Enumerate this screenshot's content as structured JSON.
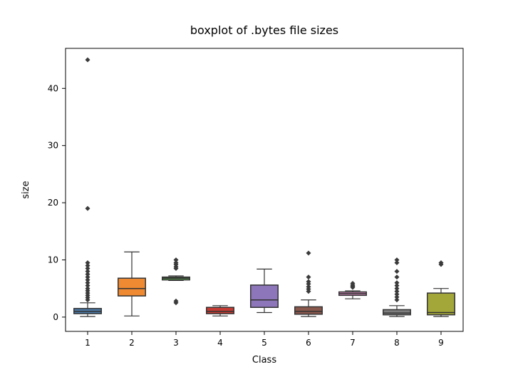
{
  "chart_data": {
    "type": "box",
    "title": "boxplot of .bytes file sizes",
    "xlabel": "Class",
    "ylabel": "size",
    "ylim": [
      -2.5,
      47
    ],
    "categories": [
      "1",
      "2",
      "3",
      "4",
      "5",
      "6",
      "7",
      "8",
      "9"
    ],
    "yticks": [
      0,
      10,
      20,
      30,
      40
    ],
    "colors": [
      "#4c79a7",
      "#ef8932",
      "#5ba053",
      "#c53a32",
      "#8d76b9",
      "#8a584d",
      "#d087bb",
      "#7f7f7f",
      "#a3a739"
    ],
    "series": [
      {
        "name": "1",
        "q1": 0.6,
        "median": 1.0,
        "q3": 1.5,
        "whisker_low": 0.1,
        "whisker_high": 2.5,
        "outliers": [
          3.0,
          3.4,
          3.8,
          4.2,
          4.6,
          5.0,
          5.5,
          6.0,
          6.5,
          7.0,
          7.5,
          8.0,
          8.5,
          9.0,
          9.5,
          19.0,
          45.0
        ]
      },
      {
        "name": "2",
        "q1": 3.7,
        "median": 5.0,
        "q3": 6.8,
        "whisker_low": 0.2,
        "whisker_high": 11.4,
        "outliers": []
      },
      {
        "name": "3",
        "q1": 6.5,
        "median": 6.8,
        "q3": 7.0,
        "whisker_low": 6.4,
        "whisker_high": 7.2,
        "outliers": [
          2.5,
          2.8,
          8.5,
          8.8,
          9.2,
          9.5,
          10.0
        ]
      },
      {
        "name": "4",
        "q1": 0.6,
        "median": 1.0,
        "q3": 1.7,
        "whisker_low": 0.2,
        "whisker_high": 2.0,
        "outliers": []
      },
      {
        "name": "5",
        "q1": 1.7,
        "median": 3.0,
        "q3": 5.6,
        "whisker_low": 0.8,
        "whisker_high": 8.4,
        "outliers": []
      },
      {
        "name": "6",
        "q1": 0.5,
        "median": 1.0,
        "q3": 1.8,
        "whisker_low": 0.1,
        "whisker_high": 3.0,
        "outliers": [
          4.5,
          4.9,
          5.3,
          5.8,
          6.2,
          7.0,
          11.2
        ]
      },
      {
        "name": "7",
        "q1": 3.8,
        "median": 4.1,
        "q3": 4.4,
        "whisker_low": 3.2,
        "whisker_high": 4.6,
        "outliers": [
          5.2,
          5.4,
          5.6,
          5.9
        ]
      },
      {
        "name": "8",
        "q1": 0.4,
        "median": 0.7,
        "q3": 1.3,
        "whisker_low": 0.1,
        "whisker_high": 2.0,
        "outliers": [
          3.0,
          3.5,
          4.0,
          4.5,
          5.0,
          5.5,
          6.0,
          7.0,
          8.0,
          9.5,
          10.0
        ]
      },
      {
        "name": "9",
        "q1": 0.4,
        "median": 0.8,
        "q3": 4.2,
        "whisker_low": 0.1,
        "whisker_high": 5.0,
        "outliers": [
          9.2,
          9.5
        ]
      }
    ]
  }
}
